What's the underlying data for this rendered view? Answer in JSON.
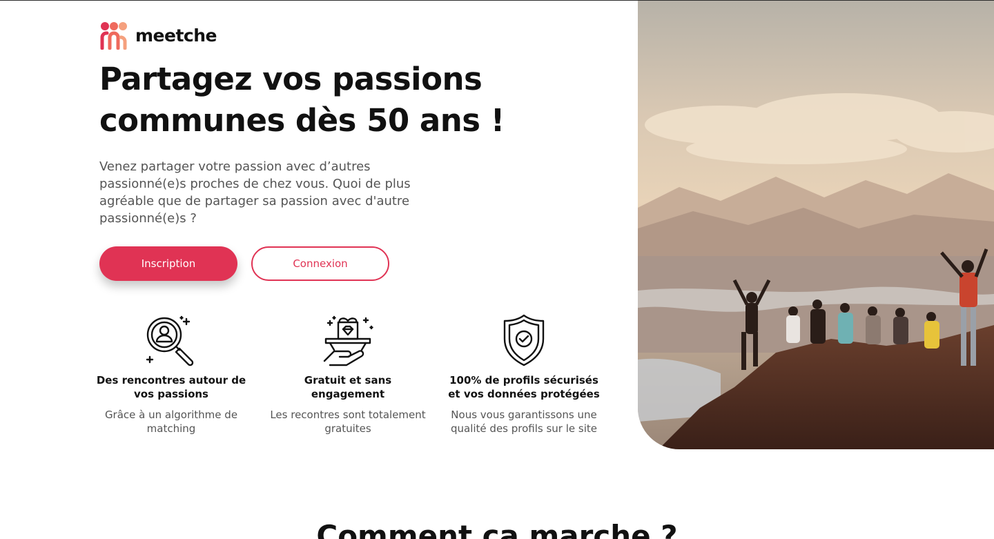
{
  "brand": {
    "name": "meetche",
    "colors": {
      "accent": "#e03354",
      "logo_dots": [
        "#e03354",
        "#ef6a5d",
        "#f5a07e"
      ]
    }
  },
  "hero": {
    "title_line1": "Partagez vos passions",
    "title_line2": "communes dès 50 ans !",
    "description": "Venez partager votre passion avec d’autres passionné(e)s proches de chez vous. Quoi de plus agréable que de partager sa passion avec d'autre passionné(e)s ?",
    "image_alt": "Groupe de seniors célébrant au sommet d'une montagne"
  },
  "actions": {
    "signup_label": "Inscription",
    "login_label": "Connexion"
  },
  "features": [
    {
      "icon": "search-profile-icon",
      "title": "Des rencontres autour de vos passions",
      "description": "Grâce à un algorithme de matching"
    },
    {
      "icon": "gift-diamond-icon",
      "title": "Gratuit et sans engagement",
      "description": "Les recontres sont totalement gratuites"
    },
    {
      "icon": "shield-check-icon",
      "title": "100% de profils sécurisés et vos données protégées",
      "description": "Nous vous garantissons une qualité des profils sur le site"
    }
  ],
  "how_it_works": {
    "heading": "Comment ça marche ?"
  }
}
